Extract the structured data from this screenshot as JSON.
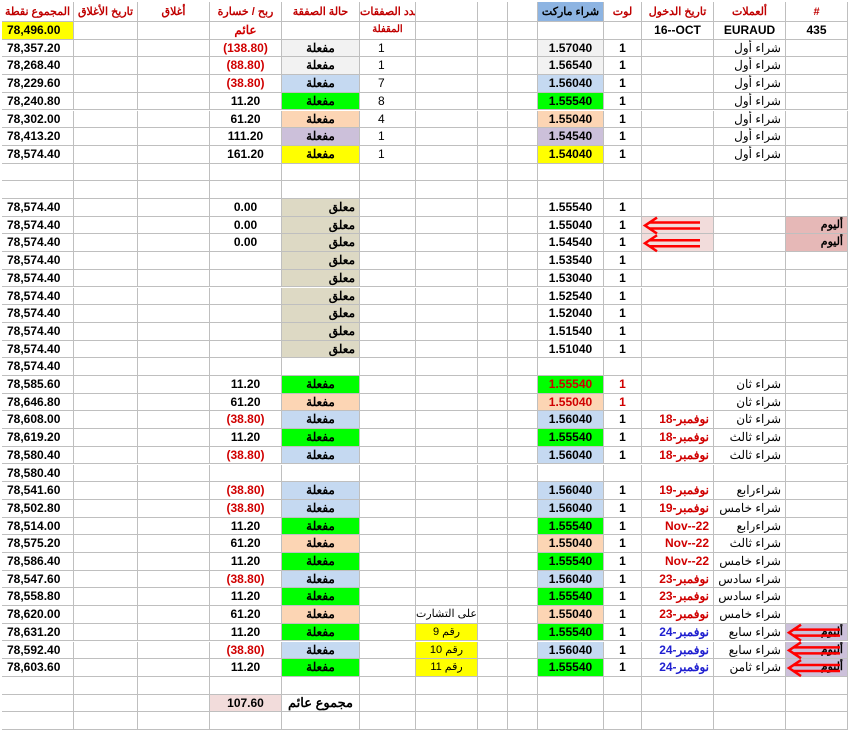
{
  "headers": {
    "total": "المجموع نقطة",
    "close_date": "تاريخ الأغلاق",
    "close": "أغلاق",
    "profit_loss": "ربح / خسارة",
    "trade_status": "حالة الصفقة",
    "trade_count": "عدد الصفقات",
    "open_trades": "المقفلة",
    "market_buy": "شراء ماركت",
    "lot": "لوت",
    "entry_date": "تاريخ الدخول",
    "currencies": "ألعملات",
    "number": "#"
  },
  "header_row2": {
    "total": "78,496.00",
    "profit_label": "عائم",
    "entry_date": "16--OCT",
    "currency": "EURAUD",
    "number": "435"
  },
  "colors": {
    "green": "#00ff00",
    "peach": "#fcd5b4",
    "lightblue": "#c5d9f1",
    "lavender": "#ccc0da",
    "yellow": "#ffff00",
    "pink": "#e6b8b7",
    "lightpink": "#f2dcdb",
    "beige": "#ddd9c4",
    "lightgray": "#f2f2f2",
    "header_total_bg": "#ffff00",
    "market_header_bg": "#8db4e2",
    "arrow": "#ff0000"
  },
  "rows": [
    {
      "total": "78,357.20",
      "pl": "(138.80)",
      "pl_red": true,
      "status": "مفعلة",
      "status_bg": "lightgray",
      "count": "1",
      "price": "1.57040",
      "price_bg": "lightgray",
      "lot": "1",
      "currency": "شراء أول"
    },
    {
      "total": "78,268.40",
      "pl": "(88.80)",
      "pl_red": true,
      "status": "مفعلة",
      "status_bg": "lightgray",
      "count": "1",
      "price": "1.56540",
      "price_bg": "lightgray",
      "lot": "1",
      "currency": "شراء أول"
    },
    {
      "total": "78,229.60",
      "pl": "(38.80)",
      "pl_red": true,
      "status": "مفعلة",
      "status_bg": "lightblue",
      "count": "7",
      "price": "1.56040",
      "price_bg": "lightblue",
      "lot": "1",
      "currency": "شراء أول"
    },
    {
      "total": "78,240.80",
      "pl": "11.20",
      "status": "مفعلة",
      "status_bg": "green",
      "count": "8",
      "price": "1.55540",
      "price_bg": "green",
      "lot": "1",
      "currency": "شراء أول"
    },
    {
      "total": "78,302.00",
      "pl": "61.20",
      "status": "مفعلة",
      "status_bg": "peach",
      "count": "4",
      "price": "1.55040",
      "price_bg": "peach",
      "lot": "1",
      "currency": "شراء أول"
    },
    {
      "total": "78,413.20",
      "pl": "111.20",
      "status": "مفعلة",
      "status_bg": "lavender",
      "count": "1",
      "price": "1.54540",
      "price_bg": "lavender",
      "lot": "1",
      "currency": "شراء أول"
    },
    {
      "total": "78,574.40",
      "pl": "161.20",
      "status": "مفعلة",
      "status_bg": "yellow",
      "count": "1",
      "price": "1.54040",
      "price_bg": "yellow",
      "lot": "1",
      "currency": "شراء أول"
    },
    {},
    {},
    {
      "total": "78,574.40",
      "pl": "0.00",
      "status": "معلق",
      "status_bg": "beige",
      "price": "1.55540",
      "lot": "1"
    },
    {
      "total": "78,574.40",
      "pl": "0.00",
      "status": "معلق",
      "status_bg": "beige",
      "price": "1.55040",
      "lot": "1",
      "entry_bg": "lightpink",
      "note": "أليوم",
      "note_bg": "pink"
    },
    {
      "total": "78,574.40",
      "pl": "0.00",
      "status": "معلق",
      "status_bg": "beige",
      "price": "1.54540",
      "lot": "1",
      "entry_bg": "lightpink",
      "note": "أليوم",
      "note_bg": "pink"
    },
    {
      "total": "78,574.40",
      "status": "معلق",
      "status_bg": "beige",
      "price": "1.53540",
      "lot": "1"
    },
    {
      "total": "78,574.40",
      "status": "معلق",
      "status_bg": "beige",
      "price": "1.53040",
      "lot": "1"
    },
    {
      "total": "78,574.40",
      "status": "معلق",
      "status_bg": "beige",
      "price": "1.52540",
      "lot": "1"
    },
    {
      "total": "78,574.40",
      "status": "معلق",
      "status_bg": "beige",
      "price": "1.52040",
      "lot": "1"
    },
    {
      "total": "78,574.40",
      "status": "معلق",
      "status_bg": "beige",
      "price": "1.51540",
      "lot": "1"
    },
    {
      "total": "78,574.40",
      "status": "معلق",
      "status_bg": "beige",
      "price": "1.51040",
      "lot": "1"
    },
    {
      "total": "78,574.40"
    },
    {
      "total": "78,585.60",
      "pl": "11.20",
      "status": "مفعلة",
      "status_bg": "green",
      "price": "1.55540",
      "price_bg": "green",
      "price_red": true,
      "lot": "1",
      "lot_red": true,
      "currency": "شراء ثان"
    },
    {
      "total": "78,646.80",
      "pl": "61.20",
      "status": "مفعلة",
      "status_bg": "peach",
      "price": "1.55040",
      "price_bg": "peach",
      "price_red": true,
      "lot": "1",
      "lot_red": true,
      "currency": "شراء ثان"
    },
    {
      "total": "78,608.00",
      "pl": "(38.80)",
      "pl_red": true,
      "status": "مفعلة",
      "status_bg": "lightblue",
      "price": "1.56040",
      "price_bg": "lightblue",
      "lot": "1",
      "entry": "نوفمبر-18",
      "entry_color": "red",
      "currency": "شراء ثان"
    },
    {
      "total": "78,619.20",
      "pl": "11.20",
      "status": "مفعلة",
      "status_bg": "green",
      "price": "1.55540",
      "price_bg": "green",
      "lot": "1",
      "entry": "نوفمبر-18",
      "entry_color": "red",
      "currency": "شراء ثالث"
    },
    {
      "total": "78,580.40",
      "pl": "(38.80)",
      "pl_red": true,
      "status": "مفعلة",
      "status_bg": "lightblue",
      "price": "1.56040",
      "price_bg": "lightblue",
      "lot": "1",
      "entry": "نوفمبر-18",
      "entry_color": "red",
      "currency": "شراء ثالث"
    },
    {
      "total": "78,580.40"
    },
    {
      "total": "78,541.60",
      "pl": "(38.80)",
      "pl_red": true,
      "status": "مفعلة",
      "status_bg": "lightblue",
      "price": "1.56040",
      "price_bg": "lightblue",
      "lot": "1",
      "entry": "نوفمبر-19",
      "entry_color": "red",
      "currency": "شراءرابع"
    },
    {
      "total": "78,502.80",
      "pl": "(38.80)",
      "pl_red": true,
      "status": "مفعلة",
      "status_bg": "lightblue",
      "price": "1.56040",
      "price_bg": "lightblue",
      "lot": "1",
      "entry": "نوفمبر-19",
      "entry_color": "red",
      "currency": "شراء خامس"
    },
    {
      "total": "78,514.00",
      "pl": "11.20",
      "status": "مفعلة",
      "status_bg": "green",
      "price": "1.55540",
      "price_bg": "green",
      "lot": "1",
      "entry": "Nov--22",
      "entry_color": "red",
      "currency": "شراءرابع"
    },
    {
      "total": "78,575.20",
      "pl": "61.20",
      "status": "مفعلة",
      "status_bg": "peach",
      "price": "1.55040",
      "price_bg": "peach",
      "lot": "1",
      "entry": "Nov--22",
      "entry_color": "red",
      "currency": "شراء ثالث"
    },
    {
      "total": "78,586.40",
      "pl": "11.20",
      "status": "مفعلة",
      "status_bg": "green",
      "price": "1.55540",
      "price_bg": "green",
      "lot": "1",
      "entry": "Nov--22",
      "entry_color": "red",
      "currency": "شراء خامس"
    },
    {
      "total": "78,547.60",
      "pl": "(38.80)",
      "pl_red": true,
      "status": "مفعلة",
      "status_bg": "lightblue",
      "price": "1.56040",
      "price_bg": "lightblue",
      "lot": "1",
      "entry": "نوفمبر-23",
      "entry_color": "red",
      "currency": "شراء سادس"
    },
    {
      "total": "78,558.80",
      "pl": "11.20",
      "status": "مفعلة",
      "status_bg": "green",
      "price": "1.55540",
      "price_bg": "green",
      "lot": "1",
      "entry": "نوفمبر-23",
      "entry_color": "red",
      "currency": "شراء سادس"
    },
    {
      "total": "78,620.00",
      "pl": "61.20",
      "status": "مفعلة",
      "status_bg": "peach",
      "price": "1.55040",
      "price_bg": "peach",
      "lot": "1",
      "entry": "نوفمبر-23",
      "entry_color": "red",
      "currency": "شراء خامس",
      "signal": "رقم على التشارت"
    },
    {
      "total": "78,631.20",
      "pl": "11.20",
      "status": "مفعلة",
      "status_bg": "green",
      "price": "1.55540",
      "price_bg": "green",
      "lot": "1",
      "entry": "نوفمبر-24",
      "entry_color": "blue",
      "currency": "شراء سابع",
      "signal": "رقم  9",
      "signal_bg": "yellow",
      "note": "أليوم",
      "note_bg": "lavender"
    },
    {
      "total": "78,592.40",
      "pl": "(38.80)",
      "pl_red": true,
      "status": "مفعلة",
      "status_bg": "lightblue",
      "price": "1.56040",
      "price_bg": "lightblue",
      "lot": "1",
      "entry": "نوفمبر-24",
      "entry_color": "blue",
      "currency": "شراء سابع",
      "signal": "رقم  10",
      "signal_bg": "yellow",
      "note": "أليوم",
      "note_bg": "lavender"
    },
    {
      "total": "78,603.60",
      "pl": "11.20",
      "status": "مفعلة",
      "status_bg": "green",
      "price": "1.55540",
      "price_bg": "green",
      "lot": "1",
      "entry": "نوفمبر-24",
      "entry_color": "blue",
      "currency": "شراء ثامن",
      "signal": "رقم  11",
      "signal_bg": "yellow",
      "note": "أليوم",
      "note_bg": "lavender"
    },
    {},
    {
      "sum_value": "107.60",
      "sum_label": "مجموع عائم"
    },
    {}
  ]
}
